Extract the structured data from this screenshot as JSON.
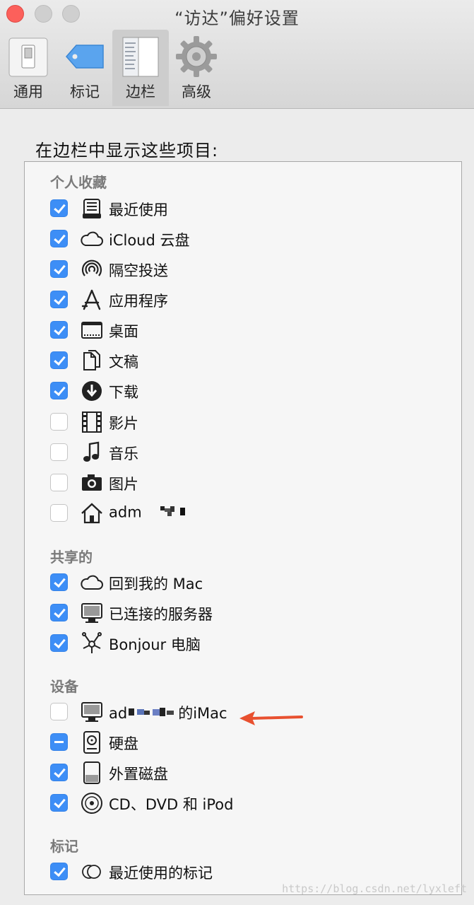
{
  "window": {
    "title": "“访达”偏好设置",
    "toolbar": [
      {
        "label": "通用",
        "icon": "switch-icon",
        "active": false
      },
      {
        "label": "标记",
        "icon": "tag-icon",
        "active": false
      },
      {
        "label": "边栏",
        "icon": "sidebar-icon",
        "active": true
      },
      {
        "label": "高级",
        "icon": "gear-icon",
        "active": false
      }
    ]
  },
  "heading": "在边栏中显示这些项目:",
  "groups": {
    "favorites": {
      "label": "个人收藏",
      "items": [
        {
          "label": "最近使用",
          "icon": "recents-icon",
          "state": "checked"
        },
        {
          "label": "iCloud 云盘",
          "icon": "cloud-icon",
          "state": "checked"
        },
        {
          "label": "隔空投送",
          "icon": "airdrop-icon",
          "state": "checked"
        },
        {
          "label": "应用程序",
          "icon": "applications-icon",
          "state": "checked"
        },
        {
          "label": "桌面",
          "icon": "desktop-icon",
          "state": "checked"
        },
        {
          "label": "文稿",
          "icon": "documents-icon",
          "state": "checked"
        },
        {
          "label": "下载",
          "icon": "download-icon",
          "state": "checked"
        },
        {
          "label": "影片",
          "icon": "film-icon",
          "state": "unchecked"
        },
        {
          "label": "音乐",
          "icon": "music-icon",
          "state": "unchecked"
        },
        {
          "label": "图片",
          "icon": "camera-icon",
          "state": "unchecked"
        },
        {
          "label": "adm",
          "icon": "home-icon",
          "state": "unchecked"
        }
      ]
    },
    "shared": {
      "label": "共享的",
      "items": [
        {
          "label": "回到我的 Mac",
          "icon": "cloud-icon",
          "state": "checked"
        },
        {
          "label": "已连接的服务器",
          "icon": "monitor-icon",
          "state": "checked"
        },
        {
          "label": "Bonjour 电脑",
          "icon": "bonjour-icon",
          "state": "checked"
        }
      ]
    },
    "devices": {
      "label": "设备",
      "items": [
        {
          "label_prefix": "ad",
          "label_suffix": "的iMac",
          "icon": "imac-icon",
          "state": "unchecked"
        },
        {
          "label": "硬盘",
          "icon": "harddisk-icon",
          "state": "mixed"
        },
        {
          "label": "外置磁盘",
          "icon": "external-disk-icon",
          "state": "checked"
        },
        {
          "label": "CD、DVD 和 iPod",
          "icon": "disc-icon",
          "state": "checked"
        }
      ]
    },
    "tags": {
      "label": "标记",
      "items": [
        {
          "label": "最近使用的标记",
          "icon": "tag-toggle-icon",
          "state": "checked"
        }
      ]
    }
  },
  "watermark": "https://blog.csdn.net/lyxleft",
  "colors": {
    "checkbox_blue": "#3d8ef6",
    "arrow": "#e8502f"
  }
}
